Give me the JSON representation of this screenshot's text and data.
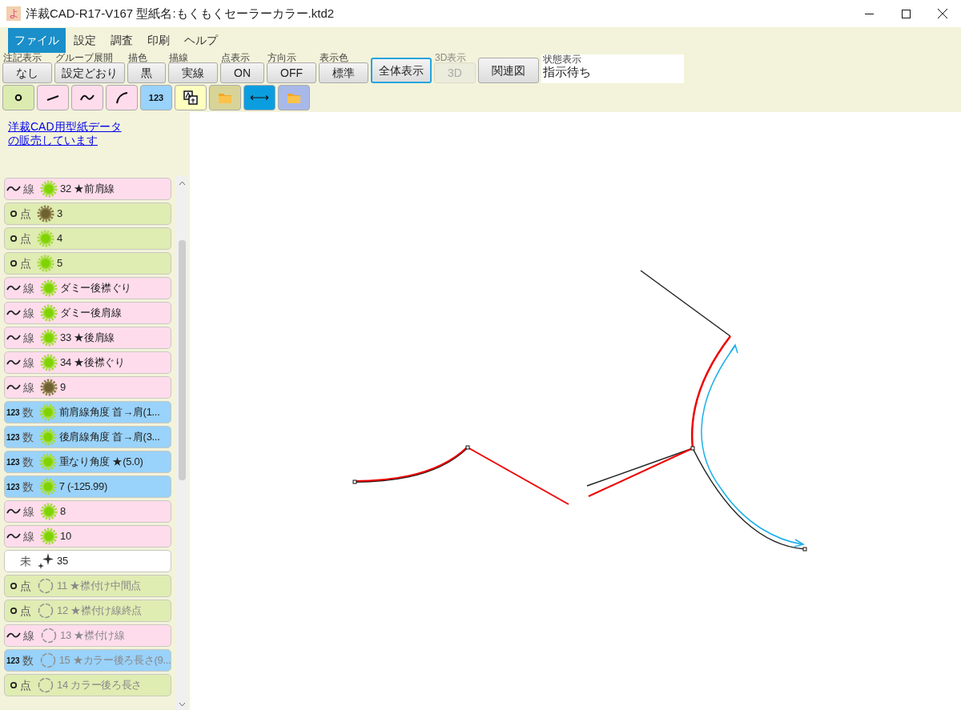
{
  "window": {
    "app_icon_glyph": "よ",
    "title": "洋裁CAD-R17-V167 型紙名:もくもくセーラーカラー.ktd2"
  },
  "menu": [
    {
      "label": "ファイル",
      "selected": true
    },
    {
      "label": "設定",
      "selected": false
    },
    {
      "label": "調査",
      "selected": false
    },
    {
      "label": "印刷",
      "selected": false
    },
    {
      "label": "ヘルプ",
      "selected": false
    }
  ],
  "toolbar": [
    {
      "caption": "注記表示",
      "value": "なし",
      "disabled": false,
      "focused": false
    },
    {
      "caption": "グループ展開",
      "value": "設定どおり",
      "disabled": false,
      "focused": false
    },
    {
      "caption": "描色",
      "value": "黒",
      "disabled": false,
      "focused": false
    },
    {
      "caption": "描線",
      "value": "実線",
      "disabled": false,
      "focused": false
    },
    {
      "caption": "点表示",
      "value": "ON",
      "disabled": false,
      "focused": false
    },
    {
      "caption": "方向示",
      "value": "OFF",
      "disabled": false,
      "focused": false
    },
    {
      "caption": "表示色",
      "value": "標準",
      "disabled": false,
      "focused": false
    },
    {
      "value": "全体表示",
      "disabled": false,
      "focused": true
    },
    {
      "caption": "3D表示",
      "value": "3D",
      "disabled": true,
      "focused": false
    },
    {
      "value": "関連図",
      "disabled": false,
      "focused": false
    }
  ],
  "status": {
    "caption": "状態表示",
    "value": "指示待ち"
  },
  "tools": [
    {
      "kind": "point",
      "color": "#dcecb0"
    },
    {
      "kind": "straight",
      "color": "#ffdcec"
    },
    {
      "kind": "curve",
      "color": "#ffdcec"
    },
    {
      "kind": "arc",
      "color": "#ffdcec"
    },
    {
      "kind": "number",
      "color": "#99d2fa",
      "label": "123"
    },
    {
      "kind": "text",
      "color": "#ffffc0"
    },
    {
      "kind": "folder",
      "color": "#d8d498"
    },
    {
      "kind": "arrow",
      "color": "#0a9ee0"
    },
    {
      "kind": "folder",
      "color": "#a8b8e8"
    }
  ],
  "promo_link": "洋裁CAD用型紙データの販売しています",
  "parts": [
    {
      "kind": "line",
      "type": "線",
      "computed": true,
      "enabled": true,
      "label": "32 ★前肩線"
    },
    {
      "kind": "point",
      "type": "点",
      "computed": true,
      "enabled": false,
      "label": "3"
    },
    {
      "kind": "point",
      "type": "点",
      "computed": true,
      "enabled": true,
      "label": "4"
    },
    {
      "kind": "point",
      "type": "点",
      "computed": true,
      "enabled": true,
      "label": "5"
    },
    {
      "kind": "line",
      "type": "線",
      "computed": true,
      "enabled": true,
      "label": "ダミー後襟ぐり"
    },
    {
      "kind": "line",
      "type": "線",
      "computed": true,
      "enabled": true,
      "label": "ダミー後肩線"
    },
    {
      "kind": "line",
      "type": "線",
      "computed": true,
      "enabled": true,
      "label": "33 ★後肩線"
    },
    {
      "kind": "line",
      "type": "線",
      "computed": true,
      "enabled": true,
      "label": "34 ★後襟ぐり"
    },
    {
      "kind": "line",
      "type": "線",
      "computed": true,
      "enabled": false,
      "label": "9"
    },
    {
      "kind": "number",
      "type": "数",
      "icon_text": "123",
      "computed": true,
      "enabled": true,
      "label": "前肩線角度 首→肩(1..."
    },
    {
      "kind": "number",
      "type": "数",
      "icon_text": "123",
      "computed": true,
      "enabled": true,
      "label": "後肩線角度 首→肩(3..."
    },
    {
      "kind": "number",
      "type": "数",
      "icon_text": "123",
      "computed": true,
      "enabled": true,
      "label": "重なり角度 ★(5.0)"
    },
    {
      "kind": "number",
      "type": "数",
      "icon_text": "123",
      "computed": true,
      "enabled": true,
      "label": "7 (-125.99)"
    },
    {
      "kind": "line",
      "type": "線",
      "computed": true,
      "enabled": true,
      "label": "8"
    },
    {
      "kind": "line",
      "type": "線",
      "computed": true,
      "enabled": true,
      "label": "10"
    },
    {
      "kind": "undefined",
      "type": "未",
      "label": "35"
    },
    {
      "kind": "point",
      "type": "点",
      "computed": false,
      "label": "11 ★襟付け中間点"
    },
    {
      "kind": "point",
      "type": "点",
      "computed": false,
      "label": "12 ★襟付け線終点"
    },
    {
      "kind": "line",
      "type": "線",
      "computed": false,
      "label": "13 ★襟付け線"
    },
    {
      "kind": "number",
      "type": "数",
      "icon_text": "123",
      "computed": false,
      "label": "15 ★カラー後ろ長さ(9..."
    },
    {
      "kind": "point",
      "type": "点",
      "computed": false,
      "label": "14 カラー後ろ長さ"
    }
  ]
}
